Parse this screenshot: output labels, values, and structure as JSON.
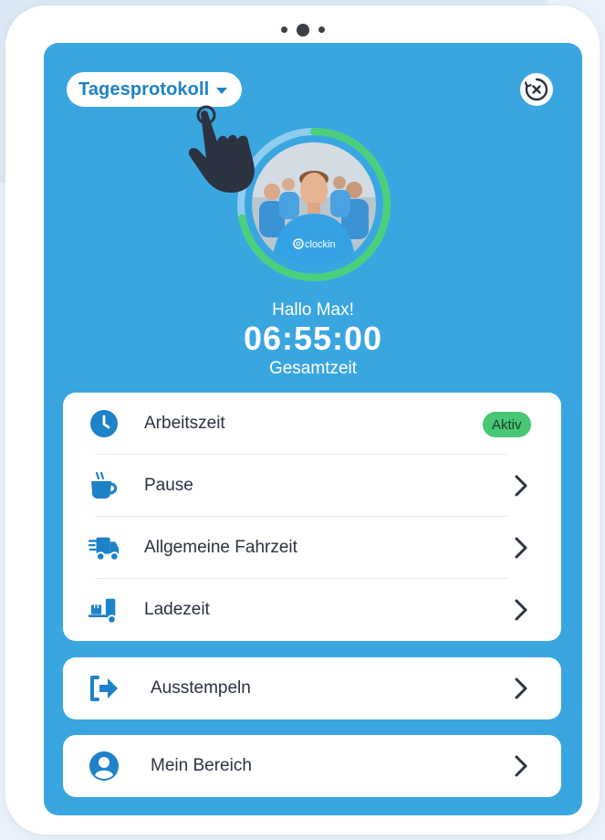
{
  "header": {
    "dropdown_label": "Tagesprotokoll"
  },
  "profile": {
    "avatar_brand": "clockin",
    "greeting": "Hallo Max!",
    "total_time": "06:55:00",
    "total_time_label": "Gesamtzeit",
    "progress": 0.72
  },
  "menu": {
    "items": [
      {
        "label": "Arbeitszeit",
        "icon": "clock-icon",
        "badge": "Aktiv"
      },
      {
        "label": "Pause",
        "icon": "coffee-cup-icon"
      },
      {
        "label": "Allgemeine Fahrzeit",
        "icon": "delivery-truck-icon"
      },
      {
        "label": "Ladezeit",
        "icon": "loading-dolly-icon"
      }
    ]
  },
  "actions": {
    "clock_out": {
      "label": "Ausstempeln",
      "icon": "sign-out-icon"
    },
    "my_area": {
      "label": "Mein Bereich",
      "icon": "user-circle-icon"
    }
  },
  "colors": {
    "screen_bg": "#3aa6e0",
    "accent_blue": "#1e82c8",
    "progress_green": "#4ad07a",
    "badge_green": "#48c774"
  }
}
